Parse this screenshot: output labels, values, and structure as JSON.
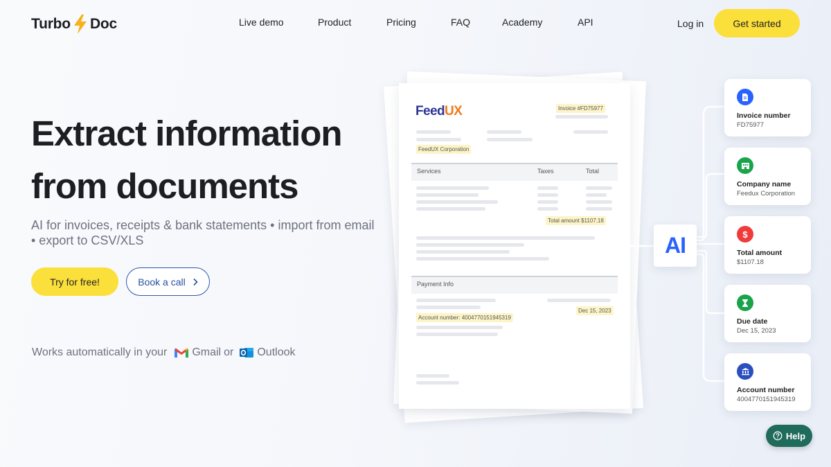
{
  "header": {
    "brand_left": "Turbo",
    "brand_right": "Doc",
    "nav": [
      {
        "label": "Live demo"
      },
      {
        "label": "Product"
      },
      {
        "label": "Pricing"
      },
      {
        "label": "FAQ"
      },
      {
        "label": "Academy"
      },
      {
        "label": "API"
      }
    ],
    "login_label": "Log in",
    "cta_label": "Get started"
  },
  "hero": {
    "title_line1": "Extract information",
    "title_line2": "from documents",
    "subtitle": "AI for invoices, receipts & bank statements • import from email • export to CSV/XLS",
    "try_label": "Try for free!",
    "call_label": "Book a call",
    "works_prefix": "Works automatically in your",
    "gmail_label": "Gmail",
    "or_label": "or",
    "outlook_label": "Outlook"
  },
  "document": {
    "brand_a": "Feed",
    "brand_b": "UX",
    "invoice_tag": "Invoice #FD75977",
    "company_tag": "FeedUX Corporation",
    "col_services": "Services",
    "col_taxes": "Taxes",
    "col_total": "Total",
    "total_tag": "Total amount  $1107.18",
    "payment_heading": "Payment Info",
    "date_tag": "Dec 15, 2023",
    "account_tag": "Account number: 4004770151945319"
  },
  "ai_label": "AI",
  "fields": [
    {
      "label": "Invoice number",
      "value": "FD75977",
      "icon": "document-icon",
      "color": "#2962ff"
    },
    {
      "label": "Company name",
      "value": "Feedux Corporation",
      "icon": "building-icon",
      "color": "#1aa34a"
    },
    {
      "label": "Total amount",
      "value": "$1107.18",
      "icon": "dollar-icon",
      "color": "#ef3b3b"
    },
    {
      "label": "Due date",
      "value": "Dec 15, 2023",
      "icon": "hourglass-icon",
      "color": "#1aa34a"
    },
    {
      "label": "Account number",
      "value": "4004770151945319",
      "icon": "bank-icon",
      "color": "#2b4fbf"
    }
  ],
  "help_label": "Help",
  "colors": {
    "accent_yellow": "#fbdf3b",
    "link_blue": "#24519f",
    "help_green": "#1f6b5c",
    "ai_blue": "#2962ff"
  }
}
